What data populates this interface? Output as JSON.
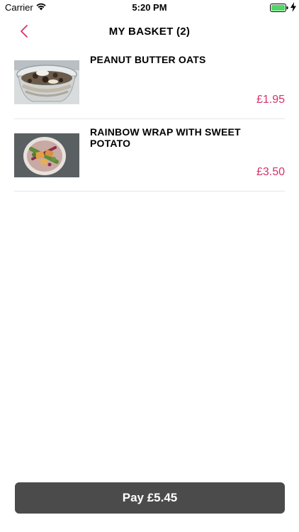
{
  "status_bar": {
    "carrier": "Carrier",
    "time": "5:20 PM",
    "icons": [
      "wifi-icon",
      "battery-icon",
      "charging-icon"
    ]
  },
  "nav": {
    "title": "MY BASKET (2)",
    "back_icon": "chevron-left-icon"
  },
  "basket": {
    "items": [
      {
        "name": "PEANUT BUTTER OATS",
        "price": "£1.95",
        "image": "oats-pot-photo"
      },
      {
        "name": "RAINBOW WRAP WITH SWEET POTATO",
        "price": "£3.50",
        "image": "wrap-photo"
      }
    ]
  },
  "pay_button": {
    "label": "Pay £5.45"
  },
  "colors": {
    "accent": "#d6336c",
    "pay_button_bg": "#4b4b4b",
    "divider": "#e6e6e6",
    "battery": "#4cd964"
  }
}
